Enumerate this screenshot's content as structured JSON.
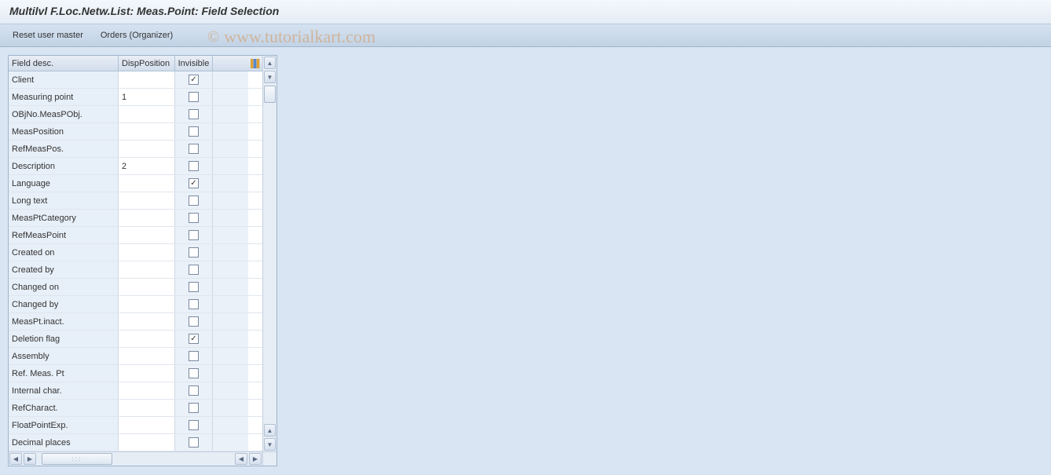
{
  "title": "Multilvl F.Loc.Netw.List: Meas.Point: Field Selection",
  "toolbar": {
    "reset_label": "Reset user master",
    "orders_label": "Orders (Organizer)"
  },
  "watermark": {
    "copyright": "©",
    "text": "www.tutorialkart.com"
  },
  "table": {
    "headers": {
      "field_desc": "Field desc.",
      "disp_position": "DispPosition",
      "invisible": "Invisible"
    },
    "hscroll_thumb_label": ":::",
    "rows": [
      {
        "field_desc": "Client",
        "disp_position": "",
        "invisible": true
      },
      {
        "field_desc": "Measuring point",
        "disp_position": "1",
        "invisible": false
      },
      {
        "field_desc": "OBjNo.MeasPObj.",
        "disp_position": "",
        "invisible": false
      },
      {
        "field_desc": "MeasPosition",
        "disp_position": "",
        "invisible": false
      },
      {
        "field_desc": "RefMeasPos.",
        "disp_position": "",
        "invisible": false
      },
      {
        "field_desc": "Description",
        "disp_position": "2",
        "invisible": false
      },
      {
        "field_desc": "Language",
        "disp_position": "",
        "invisible": true
      },
      {
        "field_desc": "Long text",
        "disp_position": "",
        "invisible": false
      },
      {
        "field_desc": "MeasPtCategory",
        "disp_position": "",
        "invisible": false
      },
      {
        "field_desc": "RefMeasPoint",
        "disp_position": "",
        "invisible": false
      },
      {
        "field_desc": "Created on",
        "disp_position": "",
        "invisible": false
      },
      {
        "field_desc": "Created by",
        "disp_position": "",
        "invisible": false
      },
      {
        "field_desc": "Changed on",
        "disp_position": "",
        "invisible": false
      },
      {
        "field_desc": "Changed by",
        "disp_position": "",
        "invisible": false
      },
      {
        "field_desc": "MeasPt.inact.",
        "disp_position": "",
        "invisible": false
      },
      {
        "field_desc": "Deletion flag",
        "disp_position": "",
        "invisible": true
      },
      {
        "field_desc": "Assembly",
        "disp_position": "",
        "invisible": false
      },
      {
        "field_desc": "Ref. Meas. Pt",
        "disp_position": "",
        "invisible": false
      },
      {
        "field_desc": "Internal char.",
        "disp_position": "",
        "invisible": false
      },
      {
        "field_desc": "RefCharact.",
        "disp_position": "",
        "invisible": false
      },
      {
        "field_desc": "FloatPointExp.",
        "disp_position": "",
        "invisible": false
      },
      {
        "field_desc": "Decimal places",
        "disp_position": "",
        "invisible": false
      }
    ]
  }
}
